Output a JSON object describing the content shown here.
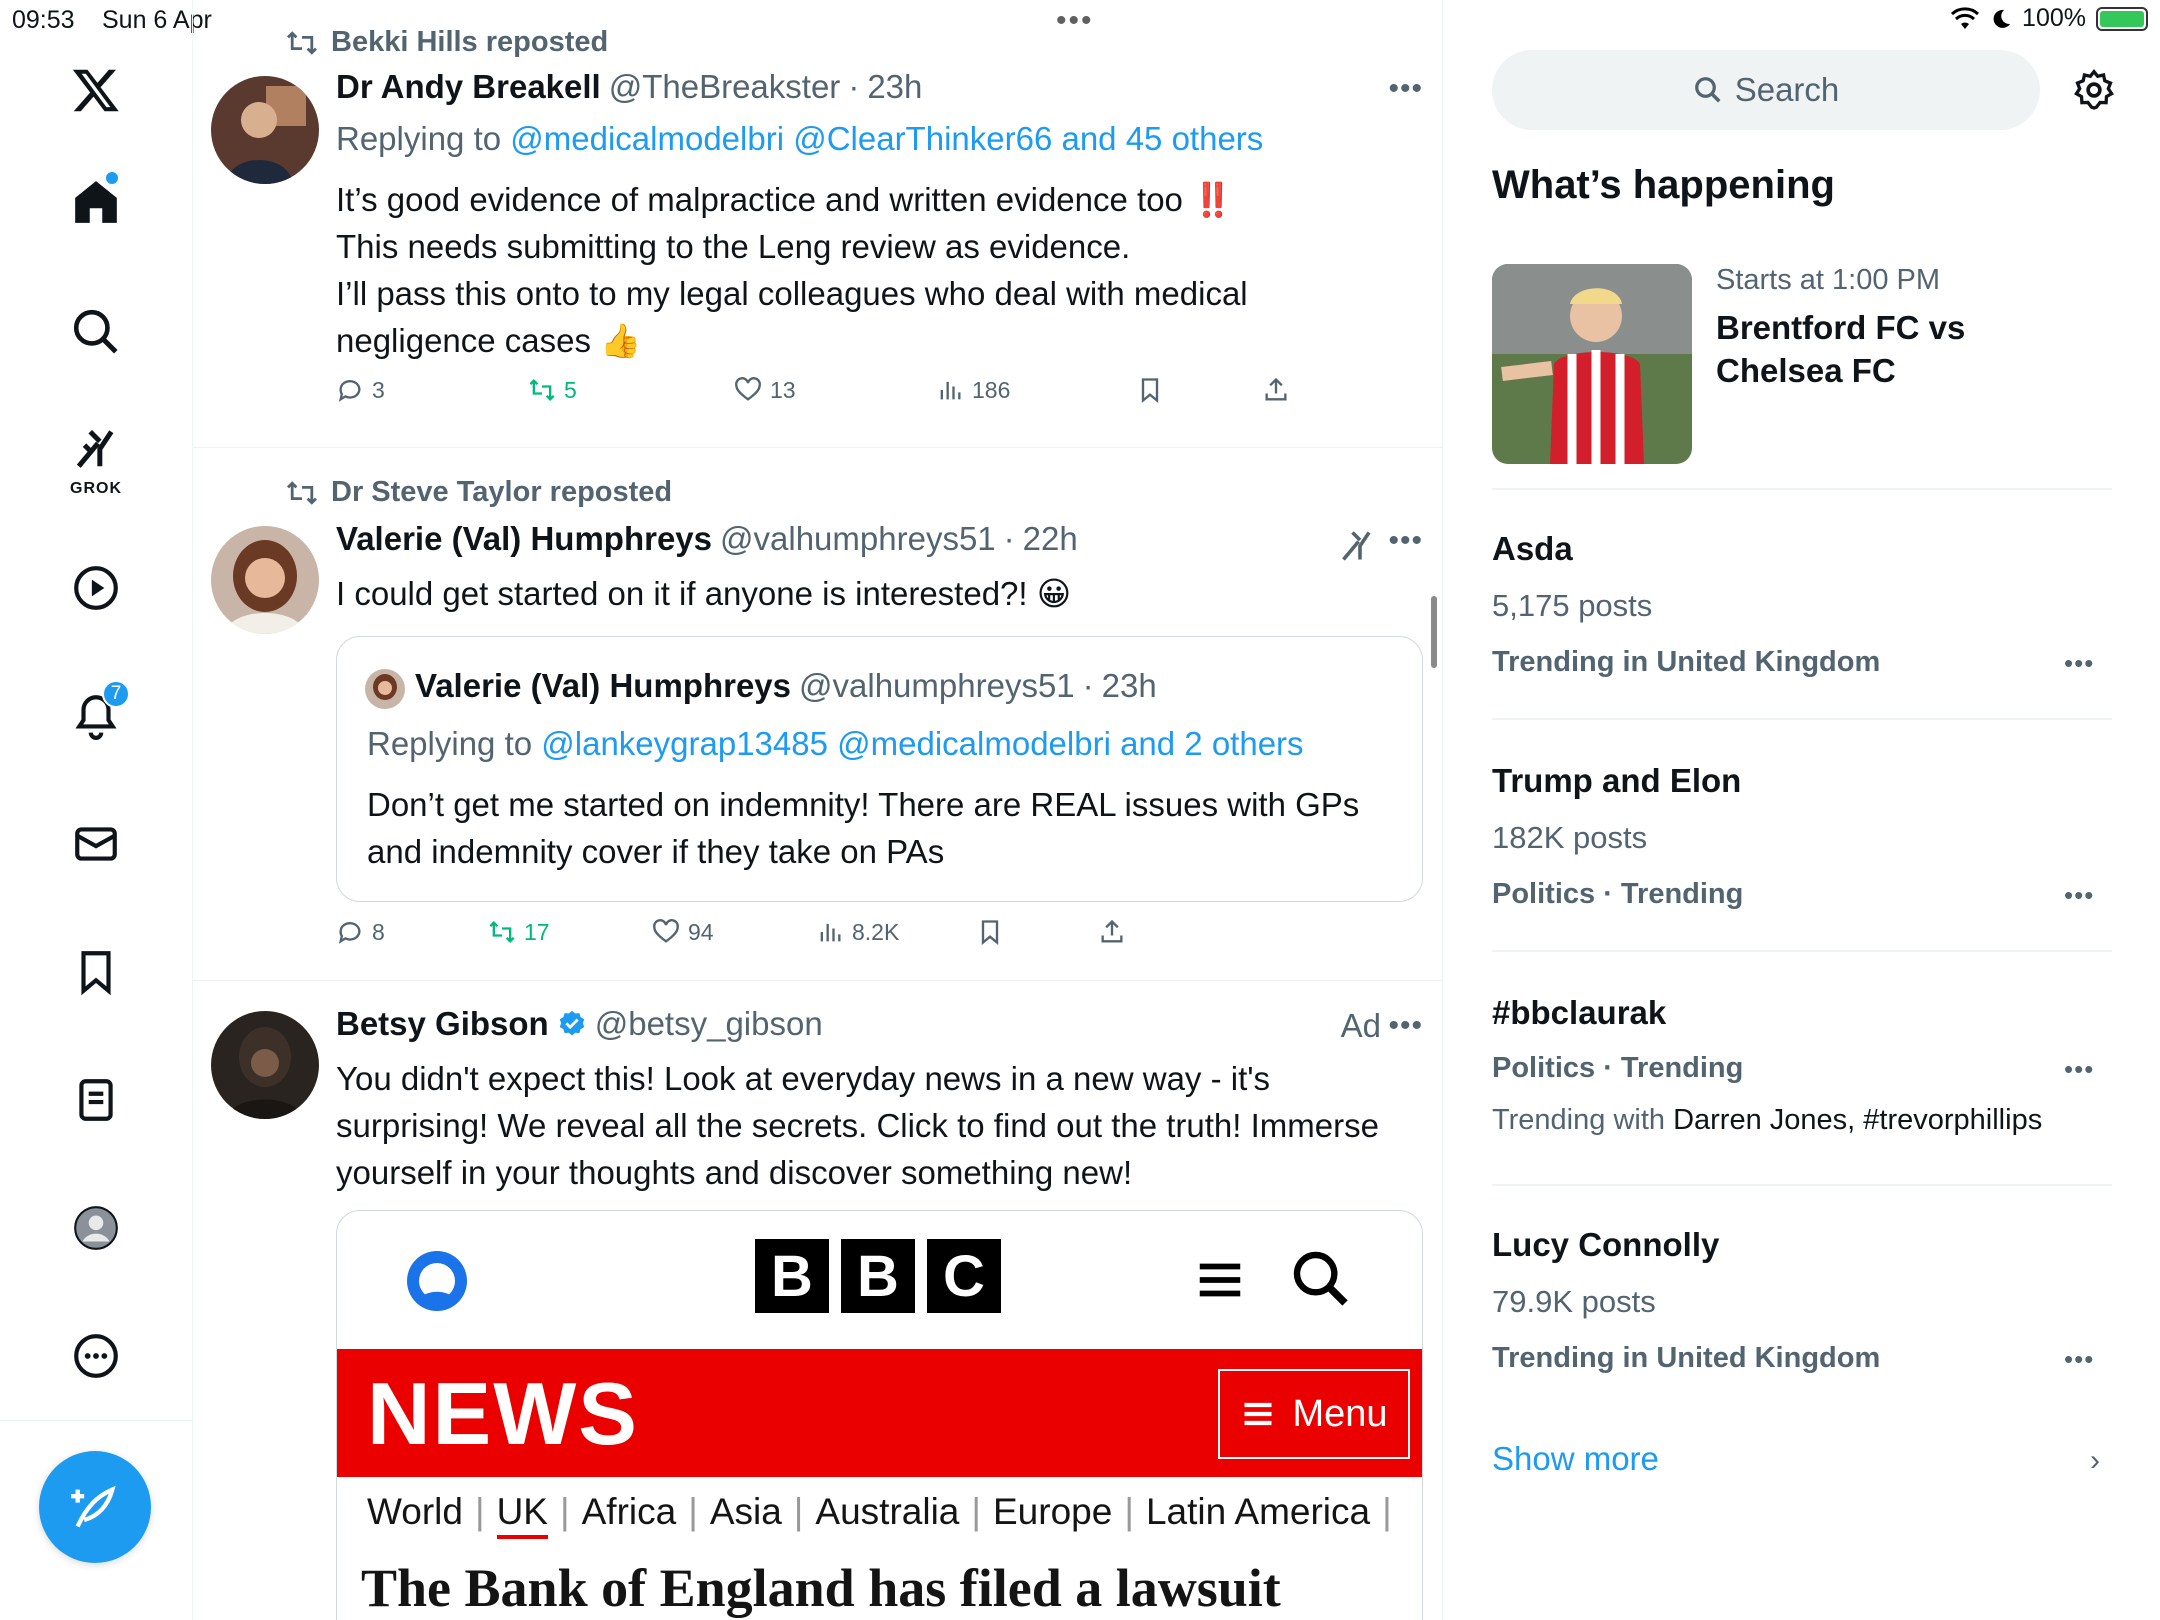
{
  "status_bar": {
    "time": "09:53",
    "date": "Sun 6 Apr",
    "battery": "100%",
    "battery_level": 1.0
  },
  "nav": {
    "grok_label": "GROK",
    "notifications_count": "7"
  },
  "tweets": [
    {
      "reposted_by": "Bekki Hills reposted",
      "name": "Dr Andy Breakell",
      "handle": "@TheBreakster",
      "time": "23h",
      "replying_prefix": "Replying to ",
      "replying_to": "@medicalmodelbri @ClearThinker66 and 45 others",
      "text_lines": [
        "It’s good evidence of malpractice and written evidence too ‼️",
        "This needs submitting to the Leng review as evidence.",
        "I’ll pass this onto to my legal colleagues who deal with medical",
        "negligence cases 👍"
      ],
      "replies": "3",
      "reposts": "5",
      "likes": "13",
      "views": "186"
    },
    {
      "reposted_by": "Dr Steve Taylor reposted",
      "name": "Valerie (Val) Humphreys",
      "handle": "@valhumphreys51",
      "time": "22h",
      "text": "I could get started on it if anyone is interested?! 😀",
      "quote": {
        "name": "Valerie (Val) Humphreys",
        "handle": "@valhumphreys51",
        "time": "23h",
        "replying_prefix": "Replying to ",
        "replying_to": "@lankeygrap13485 @medicalmodelbri and 2 others",
        "text_lines": [
          "Don’t get me started on indemnity! There are REAL issues with GPs",
          "and indemnity cover if they take on PAs"
        ]
      },
      "replies": "8",
      "reposts": "17",
      "likes": "94",
      "views": "8.2K"
    },
    {
      "name": "Betsy Gibson",
      "handle": "@betsy_gibson",
      "ad_label": "Ad",
      "text_lines": [
        "You didn't expect this! Look at everyday news in a new way - it's",
        "surprising! We reveal all the secrets. Click to find out the truth! Immerse",
        "yourself in your thoughts and discover something new!"
      ],
      "card": {
        "logo_letters": [
          "B",
          "B",
          "C"
        ],
        "news_word": "NEWS",
        "menu_label": "Menu",
        "nav_items": [
          "World",
          "UK",
          "Africa",
          "Asia",
          "Australia",
          "Europe",
          "Latin America"
        ],
        "active_nav": "UK",
        "headline": "The Bank of England has filed a lawsuit"
      }
    }
  ],
  "sidebar": {
    "search_placeholder": "Search",
    "section_title": "What’s happening",
    "event": {
      "time": "Starts at 1:00 PM",
      "title": "Brentford FC vs Chelsea FC"
    },
    "trends": [
      {
        "name": "Asda",
        "count": "5,175 posts",
        "context": "Trending in United Kingdom"
      },
      {
        "name": "Trump and Elon",
        "count": "182K posts",
        "context": "Politics · Trending"
      },
      {
        "name": "#bbclaurak",
        "context": "Politics · Trending",
        "with_prefix": "Trending with ",
        "with_names": "Darren Jones, #trevorphillips"
      },
      {
        "name": "Lucy Connolly",
        "count": "79.9K posts",
        "context": "Trending in United Kingdom"
      }
    ],
    "show_more": "Show more"
  },
  "colors": {
    "accent": "#1d9bf0",
    "repost_green": "#00ba7c",
    "bbc_red": "#eb0000",
    "muted": "#536471"
  }
}
